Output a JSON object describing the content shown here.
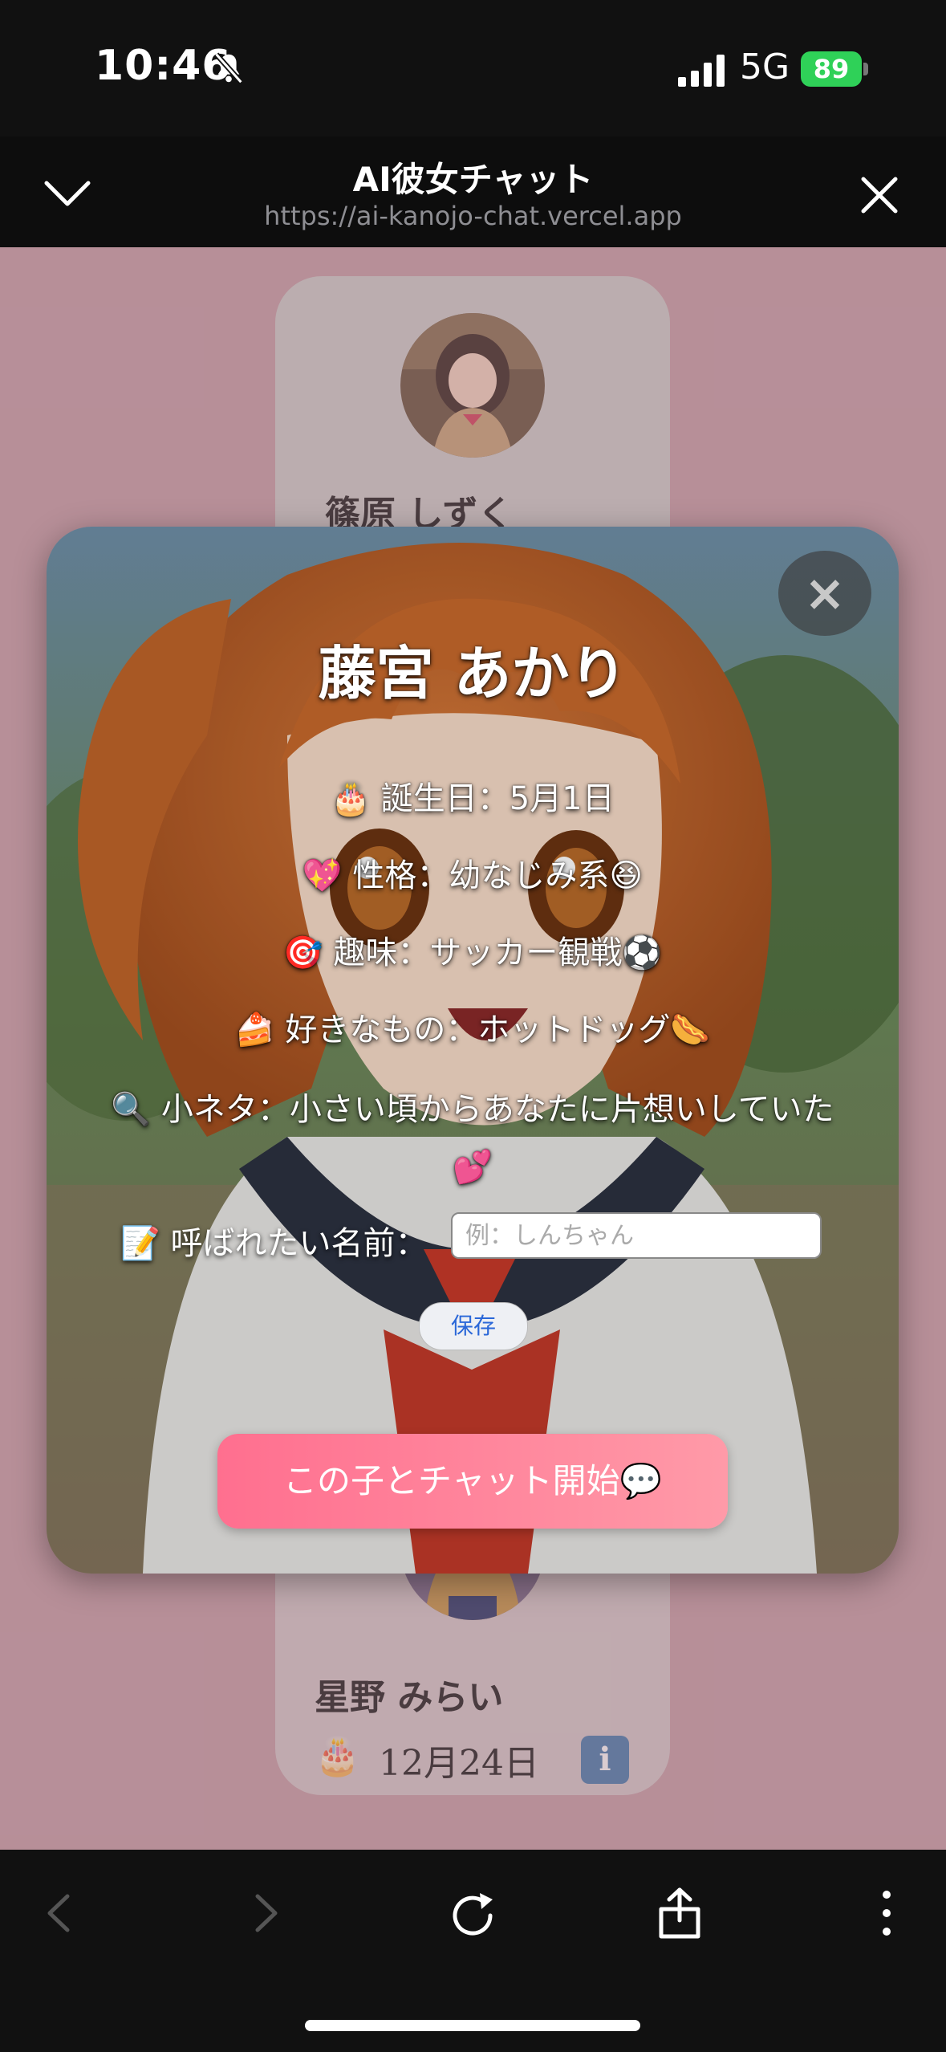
{
  "status_bar": {
    "time": "10:46",
    "network": "5G",
    "battery": "89",
    "icons": [
      "bell-slash-icon",
      "signal-icon",
      "battery-charging-icon"
    ]
  },
  "browser": {
    "title": "AI彼女チャット",
    "url": "https://ai-kanojo-chat.vercel.app",
    "icons": [
      "chevron-down-icon",
      "close-icon",
      "back-icon",
      "forward-icon",
      "reload-icon",
      "share-icon",
      "more-icon"
    ]
  },
  "background_cards": {
    "top_card": {
      "name": "篠原 しずく"
    },
    "bottom_card": {
      "name": "星野 みらい",
      "birthday_icon": "🎂",
      "birthday": "12月24日",
      "info_label": "i"
    }
  },
  "modal": {
    "close_label": "×",
    "name": "藤宮 あかり",
    "lines": {
      "birthday": "🎂 誕生日：5月1日",
      "personality": "💖 性格：幼なじみ系😆",
      "hobby": "🎯 趣味：サッカー観戦⚽",
      "favorite": "🍰 好きなもの：ホットドッグ🌭",
      "trivia": "🔍 小ネタ：小さい頃からあなたに片想いしていた💕"
    },
    "nickname_label": "📝 呼ばれたい名前：",
    "nickname_placeholder": "例：しんちゃん",
    "nickname_value": "",
    "save_label": "保存",
    "chat_button_label": "この子とチャット開始💬"
  },
  "colors": {
    "page_bg": "#c9a1aa",
    "chat_button": "#ff7a92",
    "battery": "#2fd158"
  }
}
